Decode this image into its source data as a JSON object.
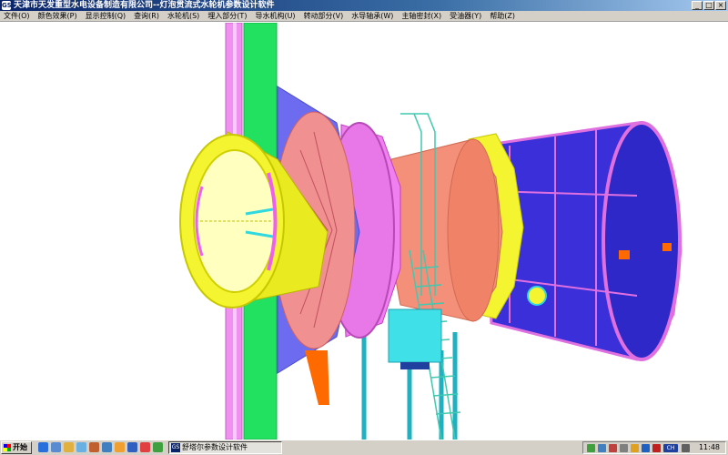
{
  "window": {
    "icon_label": "GS",
    "title": "天津市天发重型水电设备制造有限公司--灯泡贯流式水轮机参数设计软件",
    "buttons": {
      "minimize": "_",
      "maximize": "□",
      "close": "×"
    }
  },
  "menu": {
    "items": [
      {
        "label": "文件(O)"
      },
      {
        "label": "颜色效果(P)"
      },
      {
        "label": "显示控制(Q)"
      },
      {
        "label": "查询(R)"
      },
      {
        "label": "水轮机(S)"
      },
      {
        "label": "埋入部分(T)"
      },
      {
        "label": "导水机构(U)"
      },
      {
        "label": "转动部分(V)"
      },
      {
        "label": "水导轴承(W)"
      },
      {
        "label": "主轴密封(X)"
      },
      {
        "label": "受油器(Y)"
      },
      {
        "label": "帮助(Z)"
      }
    ]
  },
  "taskbar": {
    "start_label": "开始",
    "task_item_label": "舒塔尔参数设计软件",
    "task_item_icon": "GS",
    "clock": "11:48",
    "tray_lang": "CH"
  },
  "colors": {
    "titlebar": "#0a246a",
    "cone_yellow": "#f4f430",
    "pillar_green": "#22e060",
    "body_blue": "#3a2fd9",
    "shroud_salmon": "#f4907a",
    "hatch_cyan": "#30d8e0",
    "magenta_pink": "#f080f0"
  },
  "icons": [
    "app-icon",
    "start-flag-icon",
    "ie-icon",
    "desktop-icon",
    "explorer-icon",
    "volume-icon",
    "network-icon",
    "language-icon"
  ]
}
